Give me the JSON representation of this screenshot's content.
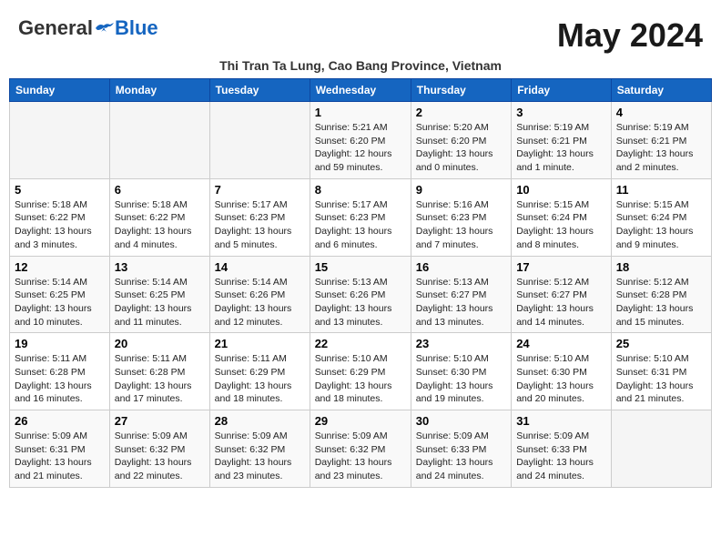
{
  "header": {
    "logo_general": "General",
    "logo_blue": "Blue",
    "month_year": "May 2024",
    "location": "Thi Tran Ta Lung, Cao Bang Province, Vietnam"
  },
  "weekdays": [
    "Sunday",
    "Monday",
    "Tuesday",
    "Wednesday",
    "Thursday",
    "Friday",
    "Saturday"
  ],
  "weeks": [
    [
      {
        "day": "",
        "sunrise": "",
        "sunset": "",
        "daylight": ""
      },
      {
        "day": "",
        "sunrise": "",
        "sunset": "",
        "daylight": ""
      },
      {
        "day": "",
        "sunrise": "",
        "sunset": "",
        "daylight": ""
      },
      {
        "day": "1",
        "sunrise": "Sunrise: 5:21 AM",
        "sunset": "Sunset: 6:20 PM",
        "daylight": "Daylight: 12 hours and 59 minutes."
      },
      {
        "day": "2",
        "sunrise": "Sunrise: 5:20 AM",
        "sunset": "Sunset: 6:20 PM",
        "daylight": "Daylight: 13 hours and 0 minutes."
      },
      {
        "day": "3",
        "sunrise": "Sunrise: 5:19 AM",
        "sunset": "Sunset: 6:21 PM",
        "daylight": "Daylight: 13 hours and 1 minute."
      },
      {
        "day": "4",
        "sunrise": "Sunrise: 5:19 AM",
        "sunset": "Sunset: 6:21 PM",
        "daylight": "Daylight: 13 hours and 2 minutes."
      }
    ],
    [
      {
        "day": "5",
        "sunrise": "Sunrise: 5:18 AM",
        "sunset": "Sunset: 6:22 PM",
        "daylight": "Daylight: 13 hours and 3 minutes."
      },
      {
        "day": "6",
        "sunrise": "Sunrise: 5:18 AM",
        "sunset": "Sunset: 6:22 PM",
        "daylight": "Daylight: 13 hours and 4 minutes."
      },
      {
        "day": "7",
        "sunrise": "Sunrise: 5:17 AM",
        "sunset": "Sunset: 6:23 PM",
        "daylight": "Daylight: 13 hours and 5 minutes."
      },
      {
        "day": "8",
        "sunrise": "Sunrise: 5:17 AM",
        "sunset": "Sunset: 6:23 PM",
        "daylight": "Daylight: 13 hours and 6 minutes."
      },
      {
        "day": "9",
        "sunrise": "Sunrise: 5:16 AM",
        "sunset": "Sunset: 6:23 PM",
        "daylight": "Daylight: 13 hours and 7 minutes."
      },
      {
        "day": "10",
        "sunrise": "Sunrise: 5:15 AM",
        "sunset": "Sunset: 6:24 PM",
        "daylight": "Daylight: 13 hours and 8 minutes."
      },
      {
        "day": "11",
        "sunrise": "Sunrise: 5:15 AM",
        "sunset": "Sunset: 6:24 PM",
        "daylight": "Daylight: 13 hours and 9 minutes."
      }
    ],
    [
      {
        "day": "12",
        "sunrise": "Sunrise: 5:14 AM",
        "sunset": "Sunset: 6:25 PM",
        "daylight": "Daylight: 13 hours and 10 minutes."
      },
      {
        "day": "13",
        "sunrise": "Sunrise: 5:14 AM",
        "sunset": "Sunset: 6:25 PM",
        "daylight": "Daylight: 13 hours and 11 minutes."
      },
      {
        "day": "14",
        "sunrise": "Sunrise: 5:14 AM",
        "sunset": "Sunset: 6:26 PM",
        "daylight": "Daylight: 13 hours and 12 minutes."
      },
      {
        "day": "15",
        "sunrise": "Sunrise: 5:13 AM",
        "sunset": "Sunset: 6:26 PM",
        "daylight": "Daylight: 13 hours and 13 minutes."
      },
      {
        "day": "16",
        "sunrise": "Sunrise: 5:13 AM",
        "sunset": "Sunset: 6:27 PM",
        "daylight": "Daylight: 13 hours and 13 minutes."
      },
      {
        "day": "17",
        "sunrise": "Sunrise: 5:12 AM",
        "sunset": "Sunset: 6:27 PM",
        "daylight": "Daylight: 13 hours and 14 minutes."
      },
      {
        "day": "18",
        "sunrise": "Sunrise: 5:12 AM",
        "sunset": "Sunset: 6:28 PM",
        "daylight": "Daylight: 13 hours and 15 minutes."
      }
    ],
    [
      {
        "day": "19",
        "sunrise": "Sunrise: 5:11 AM",
        "sunset": "Sunset: 6:28 PM",
        "daylight": "Daylight: 13 hours and 16 minutes."
      },
      {
        "day": "20",
        "sunrise": "Sunrise: 5:11 AM",
        "sunset": "Sunset: 6:28 PM",
        "daylight": "Daylight: 13 hours and 17 minutes."
      },
      {
        "day": "21",
        "sunrise": "Sunrise: 5:11 AM",
        "sunset": "Sunset: 6:29 PM",
        "daylight": "Daylight: 13 hours and 18 minutes."
      },
      {
        "day": "22",
        "sunrise": "Sunrise: 5:10 AM",
        "sunset": "Sunset: 6:29 PM",
        "daylight": "Daylight: 13 hours and 18 minutes."
      },
      {
        "day": "23",
        "sunrise": "Sunrise: 5:10 AM",
        "sunset": "Sunset: 6:30 PM",
        "daylight": "Daylight: 13 hours and 19 minutes."
      },
      {
        "day": "24",
        "sunrise": "Sunrise: 5:10 AM",
        "sunset": "Sunset: 6:30 PM",
        "daylight": "Daylight: 13 hours and 20 minutes."
      },
      {
        "day": "25",
        "sunrise": "Sunrise: 5:10 AM",
        "sunset": "Sunset: 6:31 PM",
        "daylight": "Daylight: 13 hours and 21 minutes."
      }
    ],
    [
      {
        "day": "26",
        "sunrise": "Sunrise: 5:09 AM",
        "sunset": "Sunset: 6:31 PM",
        "daylight": "Daylight: 13 hours and 21 minutes."
      },
      {
        "day": "27",
        "sunrise": "Sunrise: 5:09 AM",
        "sunset": "Sunset: 6:32 PM",
        "daylight": "Daylight: 13 hours and 22 minutes."
      },
      {
        "day": "28",
        "sunrise": "Sunrise: 5:09 AM",
        "sunset": "Sunset: 6:32 PM",
        "daylight": "Daylight: 13 hours and 23 minutes."
      },
      {
        "day": "29",
        "sunrise": "Sunrise: 5:09 AM",
        "sunset": "Sunset: 6:32 PM",
        "daylight": "Daylight: 13 hours and 23 minutes."
      },
      {
        "day": "30",
        "sunrise": "Sunrise: 5:09 AM",
        "sunset": "Sunset: 6:33 PM",
        "daylight": "Daylight: 13 hours and 24 minutes."
      },
      {
        "day": "31",
        "sunrise": "Sunrise: 5:09 AM",
        "sunset": "Sunset: 6:33 PM",
        "daylight": "Daylight: 13 hours and 24 minutes."
      },
      {
        "day": "",
        "sunrise": "",
        "sunset": "",
        "daylight": ""
      }
    ]
  ]
}
